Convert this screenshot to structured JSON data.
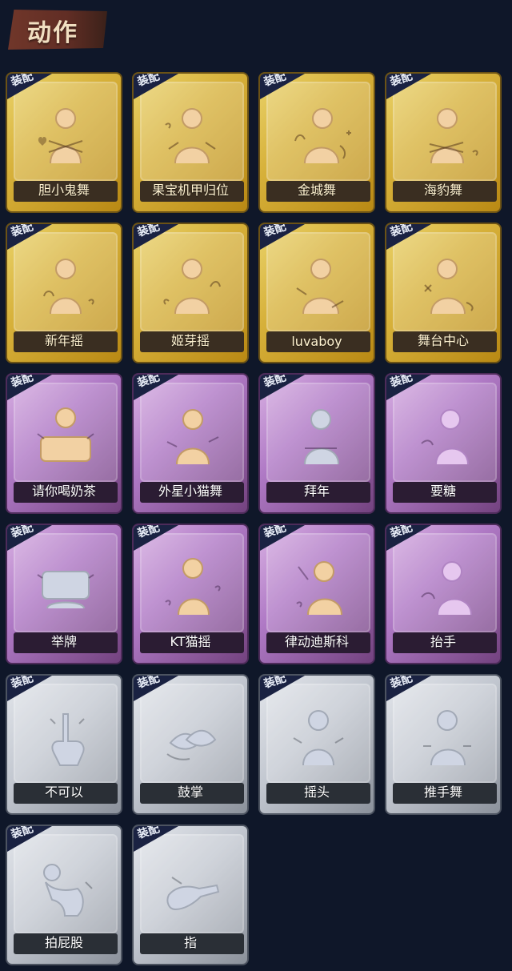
{
  "header": {
    "title": "动作"
  },
  "badge_text": "装配",
  "cards": [
    {
      "label": "胆小鬼舞",
      "tier": "gold",
      "icon": "figure-hug-icon"
    },
    {
      "label": "果宝机甲归位",
      "tier": "gold",
      "icon": "figure-pose-icon"
    },
    {
      "label": "金城舞",
      "tier": "gold",
      "icon": "figure-wave-icon"
    },
    {
      "label": "海豹舞",
      "tier": "gold",
      "icon": "figure-hug-icon"
    },
    {
      "label": "新年摇",
      "tier": "gold",
      "icon": "figure-clap-icon"
    },
    {
      "label": "姬芽摇",
      "tier": "gold",
      "icon": "figure-wave-icon"
    },
    {
      "label": "luvaboy",
      "tier": "gold",
      "icon": "figure-pose-icon"
    },
    {
      "label": "舞台中心",
      "tier": "gold",
      "icon": "figure-spin-icon"
    },
    {
      "label": "请你喝奶茶",
      "tier": "purple",
      "icon": "figure-sign-icon"
    },
    {
      "label": "外星小猫舞",
      "tier": "purple",
      "icon": "figure-dance-icon"
    },
    {
      "label": "拜年",
      "tier": "purple",
      "icon": "figure-bow-icon"
    },
    {
      "label": "要糖",
      "tier": "purple",
      "icon": "figure-hand-icon"
    },
    {
      "label": "举牌",
      "tier": "purple",
      "icon": "figure-sign-icon"
    },
    {
      "label": "KT猫摇",
      "tier": "purple",
      "icon": "figure-dance-icon"
    },
    {
      "label": "律动迪斯科",
      "tier": "purple",
      "icon": "figure-disco-icon"
    },
    {
      "label": "抬手",
      "tier": "purple",
      "icon": "figure-lift-icon"
    },
    {
      "label": "不可以",
      "tier": "gray",
      "icon": "finger-no-icon"
    },
    {
      "label": "鼓掌",
      "tier": "gray",
      "icon": "clap-hands-icon"
    },
    {
      "label": "摇头",
      "tier": "gray",
      "icon": "figure-shake-icon"
    },
    {
      "label": "推手舞",
      "tier": "gray",
      "icon": "figure-push-icon"
    },
    {
      "label": "拍屁股",
      "tier": "gray",
      "icon": "figure-bend-icon"
    },
    {
      "label": "指",
      "tier": "gray",
      "icon": "point-finger-icon"
    }
  ]
}
